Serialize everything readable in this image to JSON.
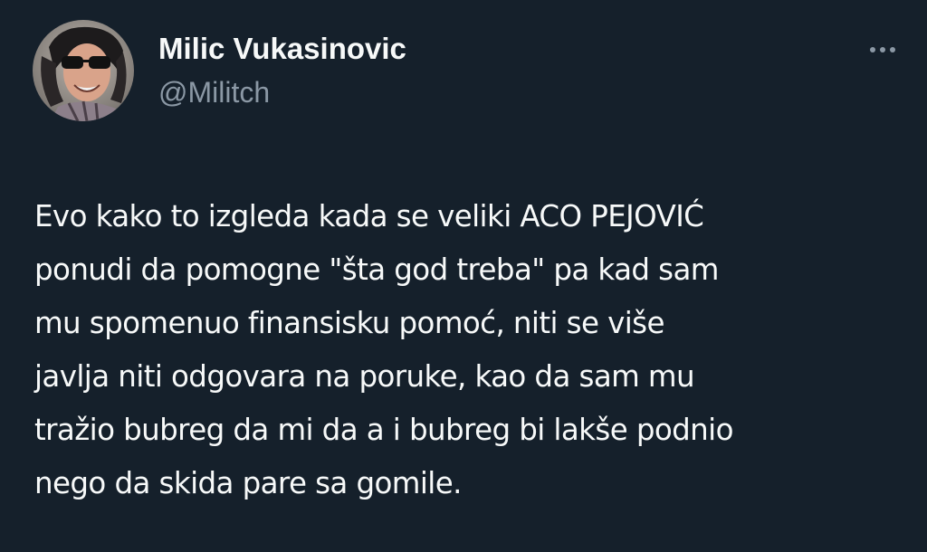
{
  "tweet": {
    "author": {
      "display_name": "Milic Vukasinovic",
      "handle": "@Militch",
      "avatar_icon": "profile-photo"
    },
    "more_icon": "more-horizontal-icon",
    "text_lines": [
      "Evo kako to izgleda kada se veliki ACO PEJOVIĆ",
      "ponudi da pomogne \"šta god treba\" pa kad sam",
      "mu spomenuo finansisku pomoć, niti se više",
      "javlja niti odgovara na poruke, kao da sam mu",
      "tražio bubreg da mi da a i bubreg bi lakše podnio",
      "nego da skida pare sa gomile."
    ]
  },
  "colors": {
    "background": "#15202b",
    "primary_text": "#f7f9f9",
    "secondary_text": "#8b98a5"
  }
}
